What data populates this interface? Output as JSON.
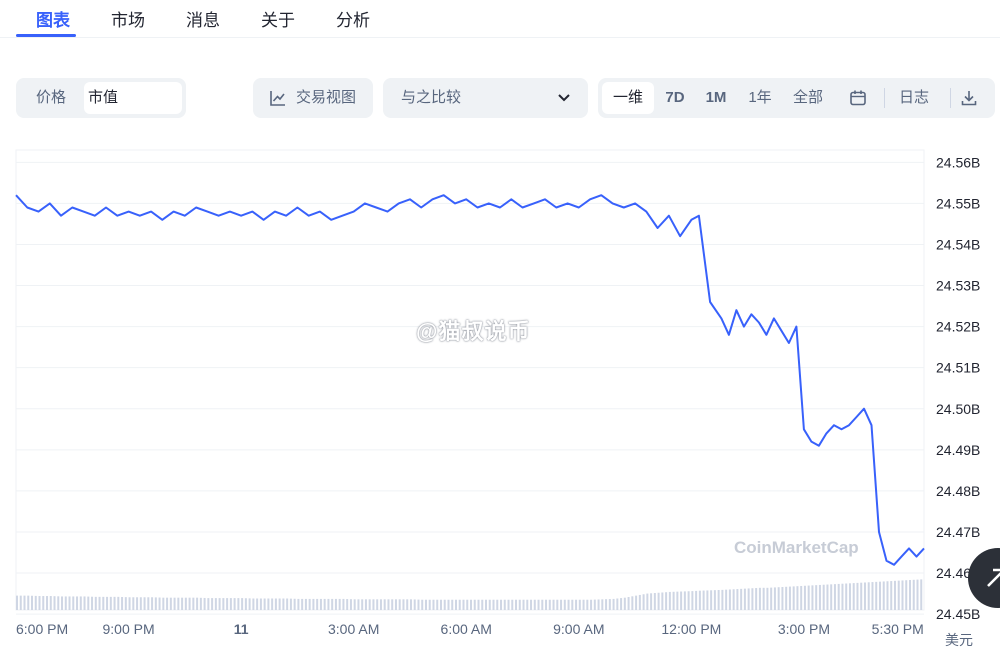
{
  "tabs": [
    {
      "label": "图表",
      "active": true
    },
    {
      "label": "市场",
      "active": false
    },
    {
      "label": "消息",
      "active": false
    },
    {
      "label": "关于",
      "active": false
    },
    {
      "label": "分析",
      "active": false
    }
  ],
  "toolbar": {
    "metric_price": "价格",
    "metric_cap": "市值",
    "trading_view": "交易视图",
    "compare": "与之比较",
    "ranges": [
      "一维",
      "7D",
      "1M",
      "1年",
      "全部"
    ],
    "active_range": "一维",
    "log": "日志"
  },
  "watermark": "@猫叔说币",
  "brand_watermark": "CoinMarketCap",
  "currency_unit": "美元",
  "colors": {
    "line": "#3861fb",
    "volume": "#cfd6e4",
    "grid": "#eff2f5",
    "accent": "#3861fb"
  },
  "icons": [
    "trading-view-icon",
    "chevron-down-icon",
    "calendar-icon",
    "download-icon",
    "scroll-up-icon"
  ],
  "chart_data": {
    "type": "line",
    "ylabel": "",
    "xlabel": "",
    "ylim": [
      24.451,
      24.563
    ],
    "y_ticks": [
      24.56,
      24.55,
      24.54,
      24.53,
      24.52,
      24.51,
      24.5,
      24.49,
      24.48,
      24.47,
      24.46,
      24.45
    ],
    "y_tick_labels": [
      "24.56B",
      "24.55B",
      "24.54B",
      "24.53B",
      "24.52B",
      "24.51B",
      "24.50B",
      "24.49B",
      "24.48B",
      "24.47B",
      "24.46B",
      "24.45B"
    ],
    "x_tick_labels": [
      "6:00 PM",
      "9:00 PM",
      "11",
      "3:00 AM",
      "6:00 AM",
      "9:00 AM",
      "12:00 PM",
      "3:00 PM",
      "5:30 PM"
    ],
    "x_tick_hours": [
      0,
      3,
      6,
      9,
      12,
      15,
      18,
      21,
      23.5
    ],
    "x_range_hours": [
      0,
      24.2
    ],
    "series": [
      {
        "x_hours": [
          0,
          0.3,
          0.6,
          0.9,
          1.2,
          1.5,
          1.8,
          2.1,
          2.4,
          2.7,
          3.0,
          3.3,
          3.6,
          3.9,
          4.2,
          4.5,
          4.8,
          5.1,
          5.4,
          5.7,
          6.0,
          6.3,
          6.6,
          6.9,
          7.2,
          7.5,
          7.8,
          8.1,
          8.4,
          8.7,
          9.0,
          9.3,
          9.6,
          9.9,
          10.2,
          10.5,
          10.8,
          11.1,
          11.4,
          11.7,
          12.0,
          12.3,
          12.6,
          12.9,
          13.2,
          13.5,
          13.8,
          14.1,
          14.4,
          14.7,
          15.0,
          15.3,
          15.6,
          15.9,
          16.2,
          16.5,
          16.8,
          17.1,
          17.4,
          17.7,
          18.0,
          18.2,
          18.5,
          18.8,
          19.0,
          19.2,
          19.4,
          19.6,
          19.8,
          20.0,
          20.2,
          20.4,
          20.6,
          20.8,
          21.0,
          21.2,
          21.4,
          21.6,
          21.8,
          22.0,
          22.2,
          22.4,
          22.6,
          22.8,
          23.0,
          23.2,
          23.4,
          23.6,
          23.8,
          24.0,
          24.2
        ],
        "values": [
          24.552,
          24.549,
          24.548,
          24.55,
          24.547,
          24.549,
          24.548,
          24.547,
          24.549,
          24.547,
          24.548,
          24.547,
          24.548,
          24.546,
          24.548,
          24.547,
          24.549,
          24.548,
          24.547,
          24.548,
          24.547,
          24.548,
          24.546,
          24.548,
          24.547,
          24.549,
          24.547,
          24.548,
          24.546,
          24.547,
          24.548,
          24.55,
          24.549,
          24.548,
          24.55,
          24.551,
          24.549,
          24.551,
          24.552,
          24.55,
          24.551,
          24.549,
          24.55,
          24.549,
          24.551,
          24.549,
          24.55,
          24.551,
          24.549,
          24.55,
          24.549,
          24.551,
          24.552,
          24.55,
          24.549,
          24.55,
          24.548,
          24.544,
          24.547,
          24.542,
          24.546,
          24.547,
          24.526,
          24.522,
          24.518,
          24.524,
          24.52,
          24.523,
          24.521,
          24.518,
          24.522,
          24.519,
          24.516,
          24.52,
          24.495,
          24.492,
          24.491,
          24.494,
          24.496,
          24.495,
          24.496,
          24.498,
          24.5,
          24.496,
          24.47,
          24.463,
          24.462,
          24.464,
          24.466,
          24.464,
          24.466
        ],
        "volume": [
          24.4545,
          24.4545,
          24.4544,
          24.4544,
          24.4543,
          24.4543,
          24.4543,
          24.4542,
          24.4542,
          24.4542,
          24.4541,
          24.4541,
          24.4541,
          24.454,
          24.454,
          24.454,
          24.454,
          24.4539,
          24.4539,
          24.4539,
          24.4539,
          24.4538,
          24.4538,
          24.4538,
          24.4538,
          24.4537,
          24.4537,
          24.4537,
          24.4537,
          24.4537,
          24.4536,
          24.4536,
          24.4536,
          24.4536,
          24.4536,
          24.4536,
          24.4535,
          24.4535,
          24.4535,
          24.4535,
          24.4535,
          24.4535,
          24.4535,
          24.4535,
          24.4535,
          24.4535,
          24.4535,
          24.4535,
          24.4535,
          24.4535,
          24.4535,
          24.4535,
          24.4536,
          24.4537,
          24.454,
          24.4545,
          24.455,
          24.4552,
          24.4554,
          24.4555,
          24.4556,
          24.4557,
          24.4558,
          24.4559,
          24.456,
          24.4561,
          24.4562,
          24.4563,
          24.4564,
          24.4564,
          24.4565,
          24.4566,
          24.4567,
          24.4568,
          24.4569,
          24.457,
          24.4571,
          24.4572,
          24.4573,
          24.4574,
          24.4575,
          24.4576,
          24.4577,
          24.4578,
          24.4579,
          24.458,
          24.4581,
          24.4582,
          24.4583,
          24.4584,
          24.4585
        ]
      }
    ],
    "grid": true,
    "line_color": "#3861fb"
  }
}
